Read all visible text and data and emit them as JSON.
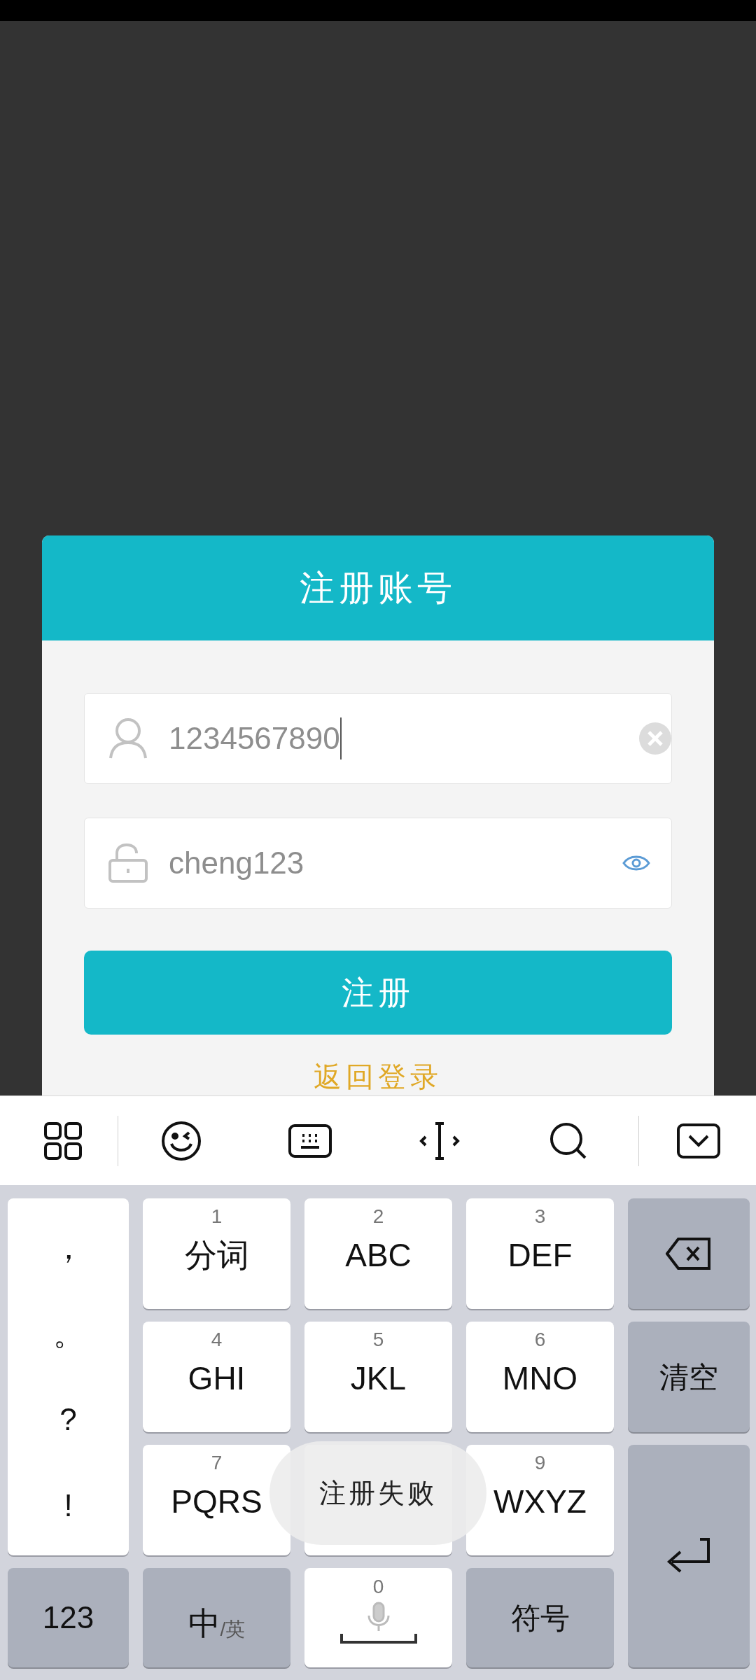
{
  "dialog": {
    "title": "注册账号",
    "fields": [
      {
        "kind": "account",
        "value": "1234567890",
        "focused": true
      },
      {
        "kind": "password",
        "value": "cheng123",
        "focused": false
      }
    ],
    "submit": "注册",
    "back_link": "返回登录"
  },
  "keyboard": {
    "punctuation": [
      "，",
      "。",
      "?",
      "!"
    ],
    "keys": [
      {
        "number": "1",
        "label": "分词"
      },
      {
        "number": "2",
        "label": "ABC"
      },
      {
        "number": "3",
        "label": "DEF"
      },
      {
        "number": "4",
        "label": "GHI"
      },
      {
        "number": "5",
        "label": "JKL"
      },
      {
        "number": "6",
        "label": "MNO"
      },
      {
        "number": "7",
        "label": "PQRS"
      },
      {
        "covered": true
      },
      {
        "number": "9",
        "label": "WXYZ"
      }
    ],
    "clear": "清空",
    "numbers": "123",
    "lang": {
      "main": "中",
      "sub": "/英"
    },
    "space_number": "0",
    "symbols": "符号"
  },
  "toast": "注册失败"
}
